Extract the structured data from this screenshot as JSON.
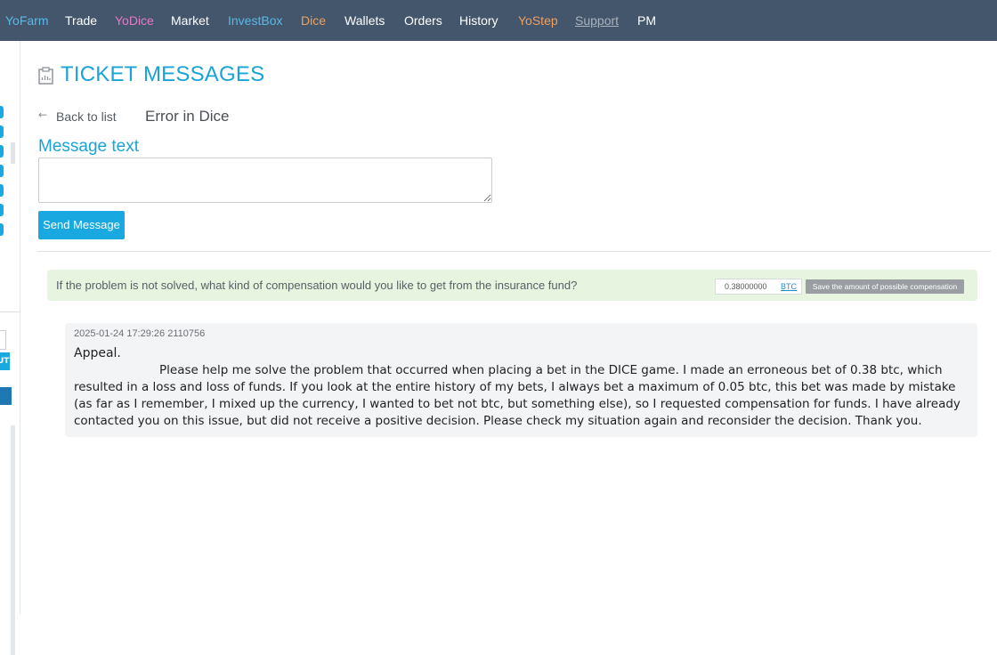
{
  "nav": {
    "items": [
      {
        "label": "YoFarm",
        "color": "#5ab9ea"
      },
      {
        "label": "Trade",
        "color": "#ffffff"
      },
      {
        "label": "YoDice",
        "color": "#e879c8"
      },
      {
        "label": "Market",
        "color": "#ffffff"
      },
      {
        "label": "InvestBox",
        "color": "#5ab9ea"
      },
      {
        "label": "Dice",
        "color": "#f0a060"
      },
      {
        "label": "Wallets",
        "color": "#ffffff"
      },
      {
        "label": "Orders",
        "color": "#ffffff"
      },
      {
        "label": "History",
        "color": "#ffffff"
      },
      {
        "label": "YoStep",
        "color": "#f0a060"
      },
      {
        "label": "Support",
        "color": "#a9b3bf"
      },
      {
        "label": "PM",
        "color": "#ffffff"
      }
    ]
  },
  "sidebar": {
    "out_label": "UT"
  },
  "page": {
    "title": "TICKET MESSAGES",
    "back_label": "Back to list",
    "ticket_subject": "Error in Dice",
    "message_label": "Message text",
    "message_value": "",
    "send_label": "Send Message"
  },
  "compensation": {
    "question": "If the problem is not solved, what kind of compensation would you like to get from the insurance fund?",
    "amount": "0.38000000",
    "currency": "BTC",
    "save_label": "Save the amount of possible compensation"
  },
  "messages": [
    {
      "meta": "2025-01-24 17:29:26 2110756",
      "greeting": "Appeal.",
      "body": "Please help me solve the problem that occurred  when placing a bet in the DICE game. I made an erroneous bet of 0.38 btc, which resulted in a loss and loss of funds. If you look at the entire history of my bets, I always bet a maximum of 0.05 btc, this bet was made by mistake (as far as I remember, I mixed up the currency, I wanted to bet not btc, but something else), so I requested compensation for funds. I have already contacted you on this issue, but did not receive a positive decision. Please check my situation again and reconsider the decision. Thank you."
    }
  ],
  "colors": {
    "nav_bg": "#43566b",
    "accent": "#1aa3d6",
    "banner_bg": "#e6f4e0",
    "card_bg": "#f3f4f6"
  }
}
